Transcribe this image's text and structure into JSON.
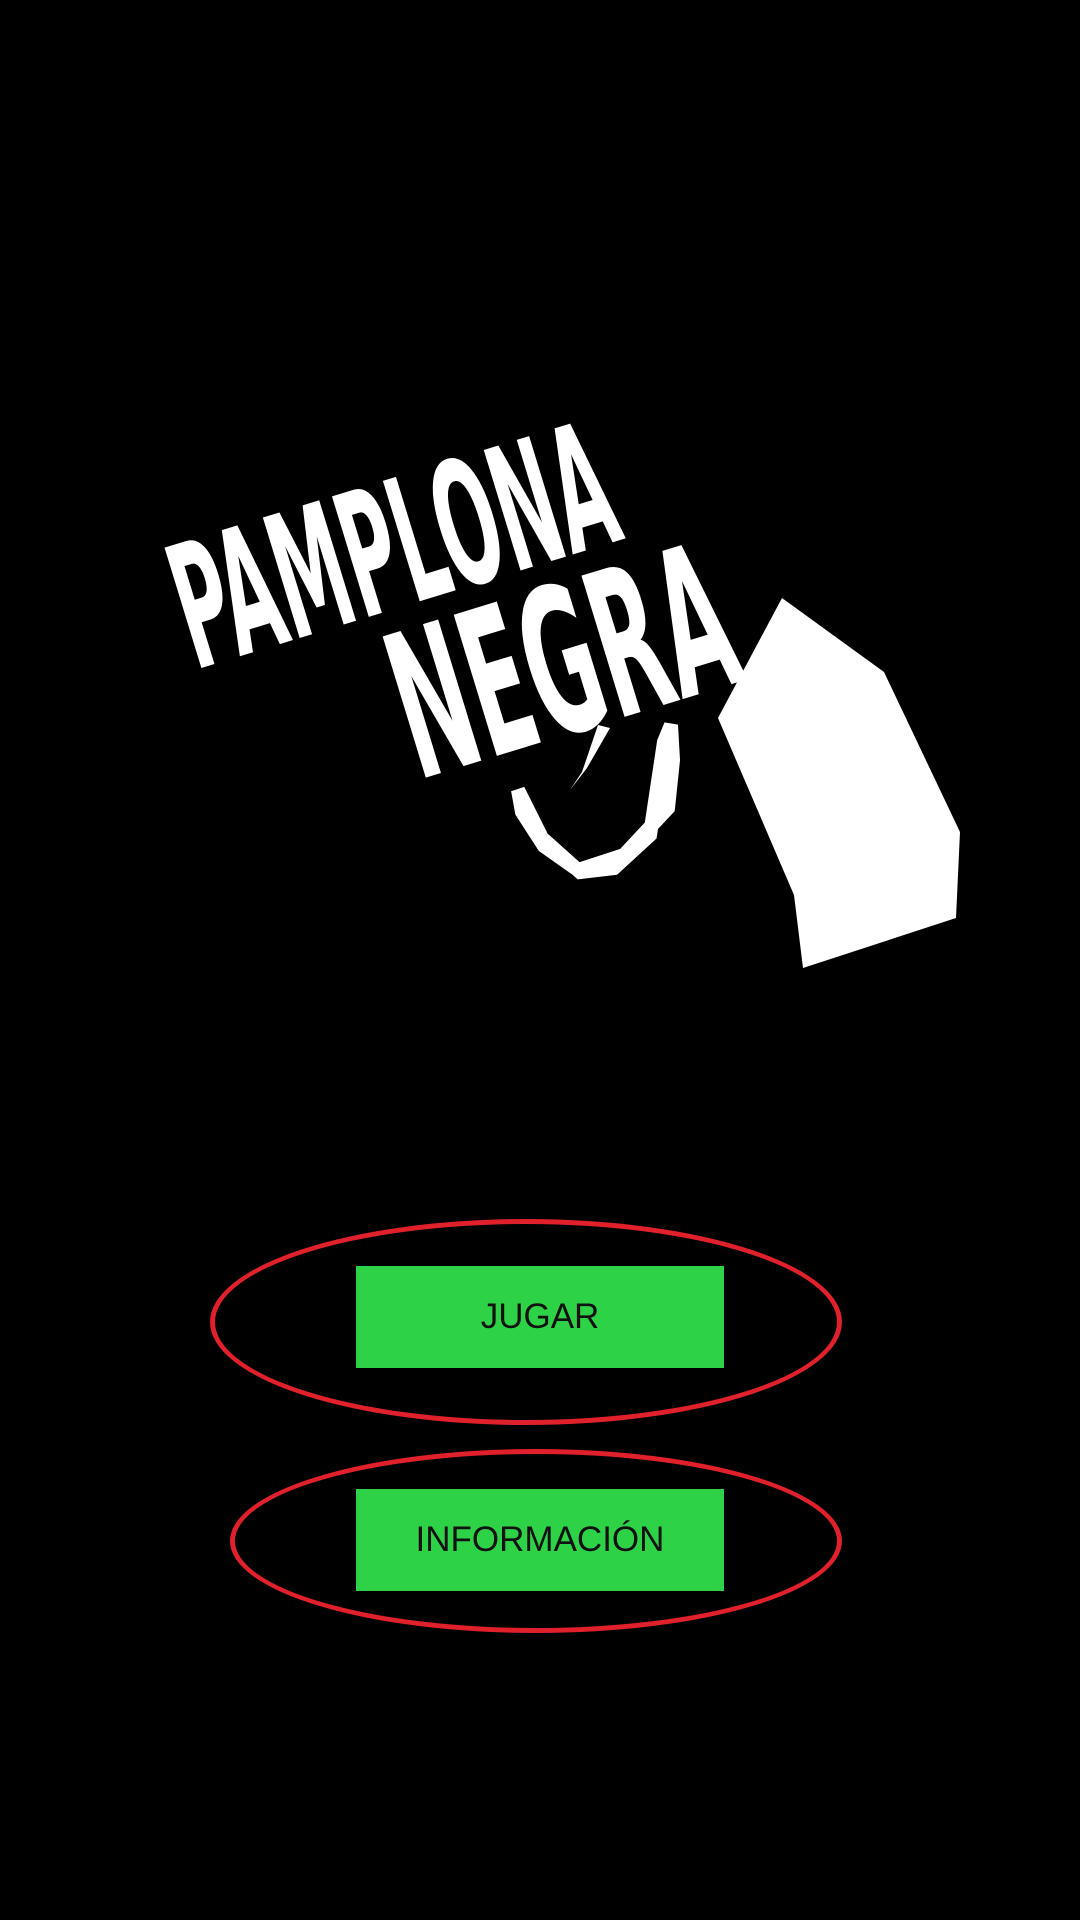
{
  "logo": {
    "line1": "PAMPLONA",
    "line2": "NEGRA",
    "icon": "hand-pointing-gun-icon"
  },
  "menu": {
    "play_label": "JUGAR",
    "info_label": "INFORMACIÓN"
  },
  "colors": {
    "background": "#000000",
    "button_bg": "#2ed246",
    "button_text": "#111111",
    "highlight": "#e0202a",
    "logo": "#ffffff"
  }
}
